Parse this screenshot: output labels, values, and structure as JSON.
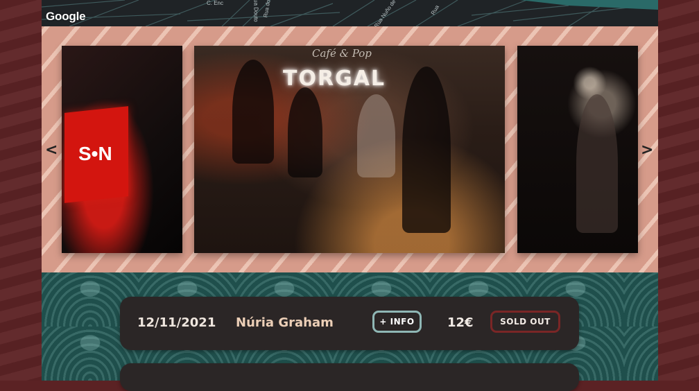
{
  "map": {
    "attribution": "Google",
    "street_labels": [
      "C. Enc",
      "Rua Douto",
      "Rua do",
      "Rua Nuño de C",
      "Rua"
    ]
  },
  "gallery": {
    "prev_icon": "chevron-left-icon",
    "next_icon": "chevron-right-icon",
    "prev_glyph": "<",
    "next_glyph": ">",
    "slides": [
      {
        "sign_text": "S•N"
      },
      {
        "sign_text": "TORGAL",
        "sign_sub": "Café & Pop"
      },
      {}
    ]
  },
  "events": [
    {
      "date": "12/11/2021",
      "artist": "Núria Graham",
      "info_label": "+ INFO",
      "price": "12€",
      "status": "SOLD OUT"
    }
  ],
  "colors": {
    "maroon": "#5b2224",
    "gallery_stripe": "#d69b8a",
    "teal": "#1f4f4c",
    "row_bg": "#2b2626",
    "info_border": "#8fb7b5",
    "sold_border": "#7a2626"
  }
}
